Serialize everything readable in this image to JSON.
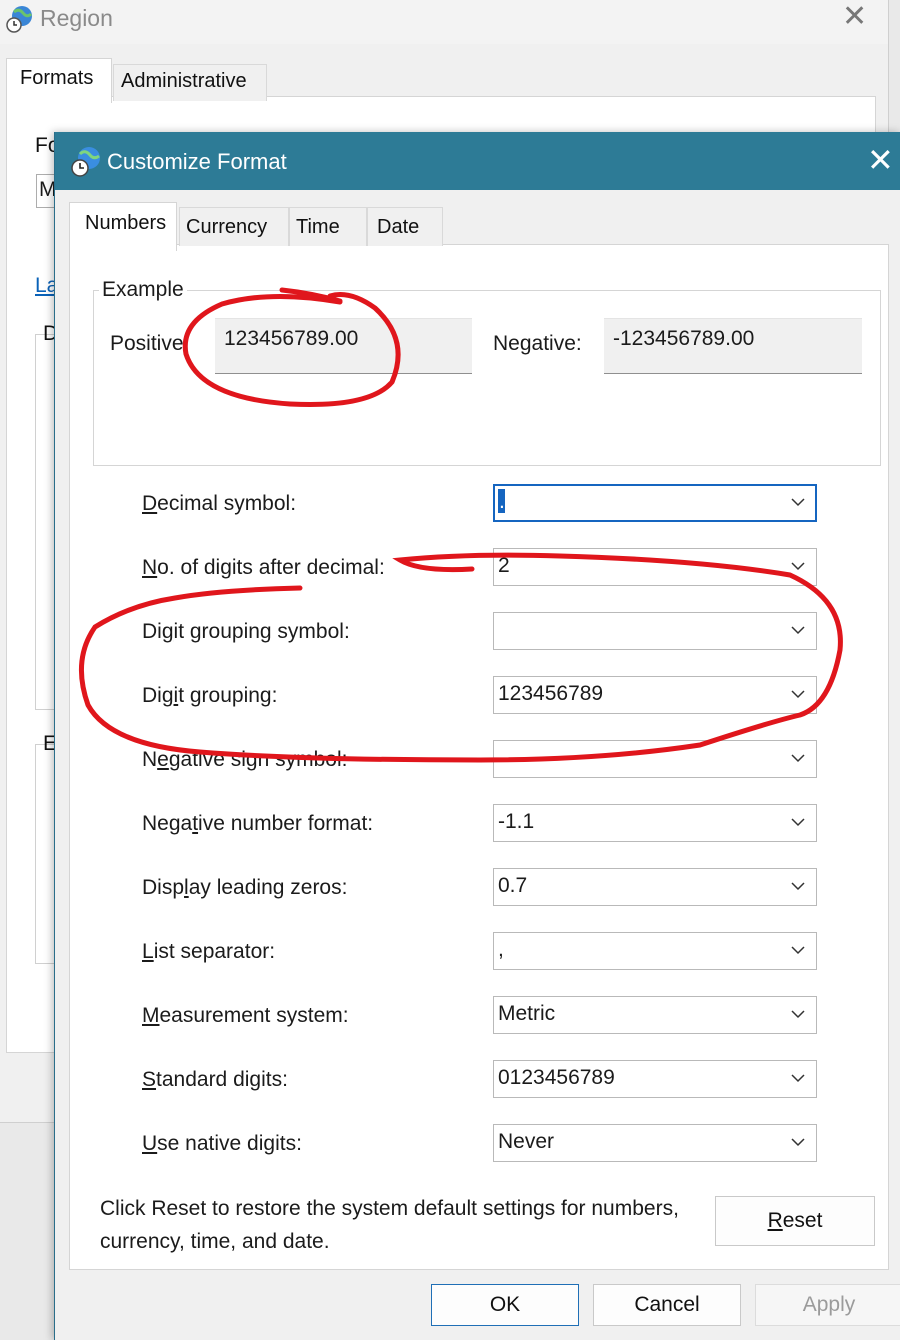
{
  "region_window": {
    "title": "Region",
    "tabs": [
      {
        "label": "Formats",
        "active": true
      },
      {
        "label": "Administrative",
        "active": false
      }
    ],
    "fragments": {
      "format_label": "Fo",
      "format_value": "M",
      "link": "La",
      "group1_header": "D",
      "group2_header": "E"
    }
  },
  "dialog": {
    "title": "Customize Format",
    "tabs": [
      {
        "label": "Numbers",
        "active": true
      },
      {
        "label": "Currency",
        "active": false
      },
      {
        "label": "Time",
        "active": false
      },
      {
        "label": "Date",
        "active": false
      }
    ],
    "example": {
      "legend": "Example",
      "positive_label": "Positive:",
      "positive_value": "123456789.00",
      "negative_label": "Negative:",
      "negative_value": "-123456789.00"
    },
    "settings": [
      {
        "key": "decimal_symbol",
        "label_pre": "",
        "label_u": "D",
        "label_post": "ecimal symbol:",
        "value": ".",
        "focused": true
      },
      {
        "key": "digits_after_decimal",
        "label_pre": "",
        "label_u": "N",
        "label_post": "o. of digits after decimal:",
        "value": "2",
        "focused": false
      },
      {
        "key": "digit_grouping_symbol",
        "label_pre": "Di",
        "label_u": "g",
        "label_post": "it grouping symbol:",
        "value": "",
        "focused": false
      },
      {
        "key": "digit_grouping",
        "label_pre": "Dig",
        "label_u": "i",
        "label_post": "t grouping:",
        "value": "123456789",
        "focused": false
      },
      {
        "key": "negative_sign_symbol",
        "label_pre": "N",
        "label_u": "e",
        "label_post": "gative sign symbol:",
        "value": "",
        "focused": false
      },
      {
        "key": "negative_number_format",
        "label_pre": "Nega",
        "label_u": "t",
        "label_post": "ive number format:",
        "value": "-1.1",
        "focused": false
      },
      {
        "key": "display_leading_zeros",
        "label_pre": "Disp",
        "label_u": "l",
        "label_post": "ay leading zeros:",
        "value": "0.7",
        "focused": false
      },
      {
        "key": "list_separator",
        "label_pre": "",
        "label_u": "L",
        "label_post": "ist separator:",
        "value": ",",
        "focused": false
      },
      {
        "key": "measurement_system",
        "label_pre": "",
        "label_u": "M",
        "label_post": "easurement system:",
        "value": "Metric",
        "focused": false
      },
      {
        "key": "standard_digits",
        "label_pre": "",
        "label_u": "S",
        "label_post": "tandard digits:",
        "value": "0123456789",
        "focused": false
      },
      {
        "key": "use_native_digits",
        "label_pre": "",
        "label_u": "U",
        "label_post": "se native digits:",
        "value": "Never",
        "focused": false
      }
    ],
    "reset_text": "Click Reset to restore the system default settings for numbers, currency, time, and date.",
    "reset_button": {
      "label_u": "R",
      "label_post": "eset"
    },
    "buttons": {
      "ok": "OK",
      "cancel": "Cancel",
      "apply": "Apply"
    }
  },
  "colors": {
    "titlebar": "#2d7b96",
    "annotation": "#e0161c",
    "focus": "#1565c0"
  },
  "icons": {
    "dialog_icon": "globe-clock-icon",
    "dropdown_icon": "chevron-down-icon",
    "close_icon": "close-icon"
  }
}
